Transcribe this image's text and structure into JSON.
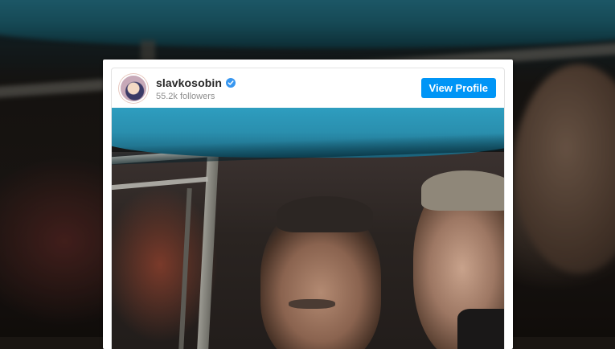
{
  "profile": {
    "username": "slavkosobin",
    "verified": true,
    "followers": "55.2k followers",
    "view_profile_label": "View Profile"
  },
  "icons": {
    "verified": "verified-badge-icon",
    "avatar": "profile-avatar"
  },
  "colors": {
    "accent": "#0095f6",
    "verified": "#3897f0",
    "username": "#262626",
    "secondary_text": "#8e8e8e"
  }
}
